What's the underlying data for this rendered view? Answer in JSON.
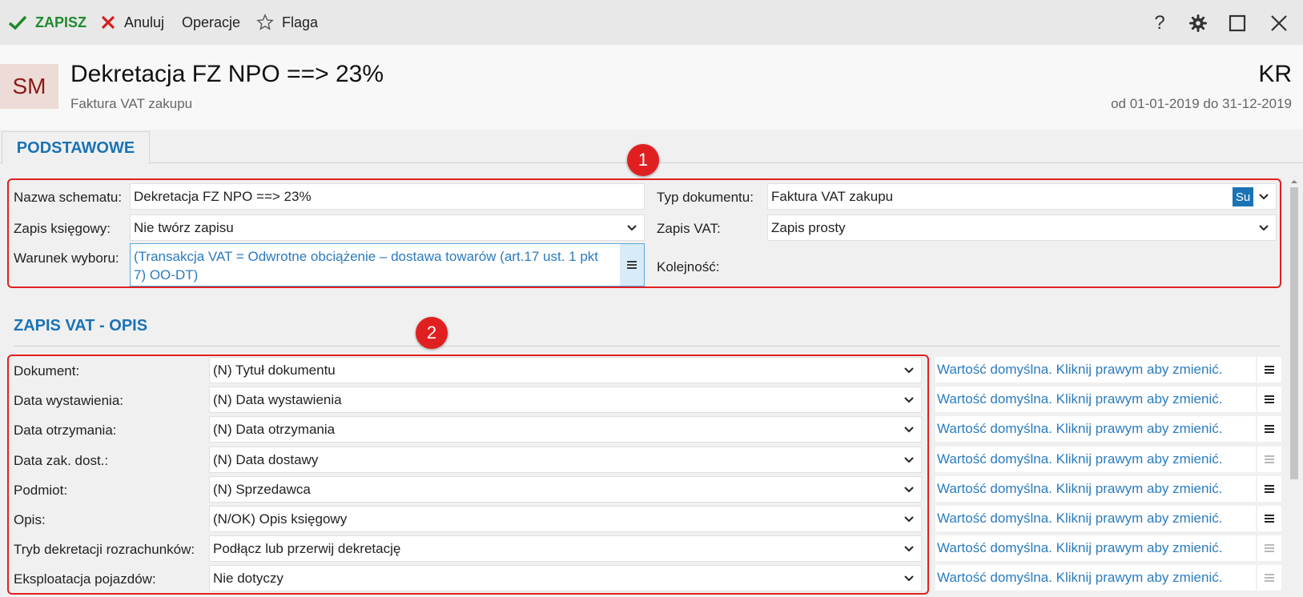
{
  "toolbar": {
    "save_label": "ZAPISZ",
    "cancel_label": "Anuluj",
    "operations_label": "Operacje",
    "flag_label": "Flaga"
  },
  "header": {
    "avatar": "SM",
    "title": "Dekretacja FZ NPO ==> 23%",
    "subtitle": "Faktura VAT zakupu",
    "code": "KR",
    "date_range": "od 01-01-2019 do 31-12-2019"
  },
  "tabs": [
    {
      "label": "PODSTAWOWE"
    }
  ],
  "form": {
    "schema_name_label": "Nazwa schematu:",
    "schema_name_value": "Dekretacja FZ NPO ==> 23%",
    "doc_type_label": "Typ dokumentu:",
    "doc_type_value": "Faktura VAT zakupu",
    "doc_type_badge": "Su",
    "posting_label": "Zapis księgowy:",
    "posting_value": "Nie twórz zapisu",
    "vat_entry_label": "Zapis VAT:",
    "vat_entry_value": "Zapis prosty",
    "condition_label": "Warunek wyboru:",
    "condition_value": "(Transakcja VAT = Odwrotne obciążenie – dostawa towarów (art.17 ust. 1 pkt 7) OO-DT)",
    "order_label": "Kolejność:"
  },
  "vat_section": {
    "title": "ZAPIS VAT - OPIS",
    "rows": [
      {
        "label": "Dokument:",
        "value": "(N) Tytuł dokumentu",
        "link": "Wartość domyślna. Kliknij prawym aby zmienić.",
        "menu_active": true
      },
      {
        "label": "Data wystawienia:",
        "value": "(N) Data wystawienia",
        "link": "Wartość domyślna. Kliknij prawym aby zmienić.",
        "menu_active": true
      },
      {
        "label": "Data otrzymania:",
        "value": "(N) Data otrzymania",
        "link": "Wartość domyślna. Kliknij prawym aby zmienić.",
        "menu_active": true
      },
      {
        "label": "Data zak. dost.:",
        "value": "(N) Data dostawy",
        "link": "Wartość domyślna. Kliknij prawym aby zmienić.",
        "menu_active": false
      },
      {
        "label": "Podmiot:",
        "value": "(N) Sprzedawca",
        "link": "Wartość domyślna. Kliknij prawym aby zmienić.",
        "menu_active": true
      },
      {
        "label": "Opis:",
        "value": "(N/OK) Opis księgowy",
        "link": "Wartość domyślna. Kliknij prawym aby zmienić.",
        "menu_active": true
      },
      {
        "label": "Tryb dekretacji rozrachunków:",
        "value": "Podłącz lub przerwij dekretację",
        "link": "Wartość domyślna. Kliknij prawym aby zmienić.",
        "menu_active": false
      },
      {
        "label": "Eksploatacja pojazdów:",
        "value": "Nie dotyczy",
        "link": "Wartość domyślna. Kliknij prawym aby zmienić.",
        "menu_active": false
      }
    ]
  },
  "annotations": [
    {
      "label": "1"
    },
    {
      "label": "2"
    }
  ],
  "colors": {
    "accent": "#1a73b5",
    "save_green": "#1f8a2e",
    "cancel_red": "#d42020",
    "annotation_red": "#e02020",
    "link_blue": "#2a7bbf",
    "avatar_bg": "#ecdbd6",
    "avatar_fg": "#8a1a14"
  },
  "icons": [
    "check-icon",
    "x-icon",
    "star-icon",
    "help-icon",
    "gear-icon",
    "maximize-icon",
    "close-icon",
    "chevron-down-icon",
    "menu-icon"
  ]
}
